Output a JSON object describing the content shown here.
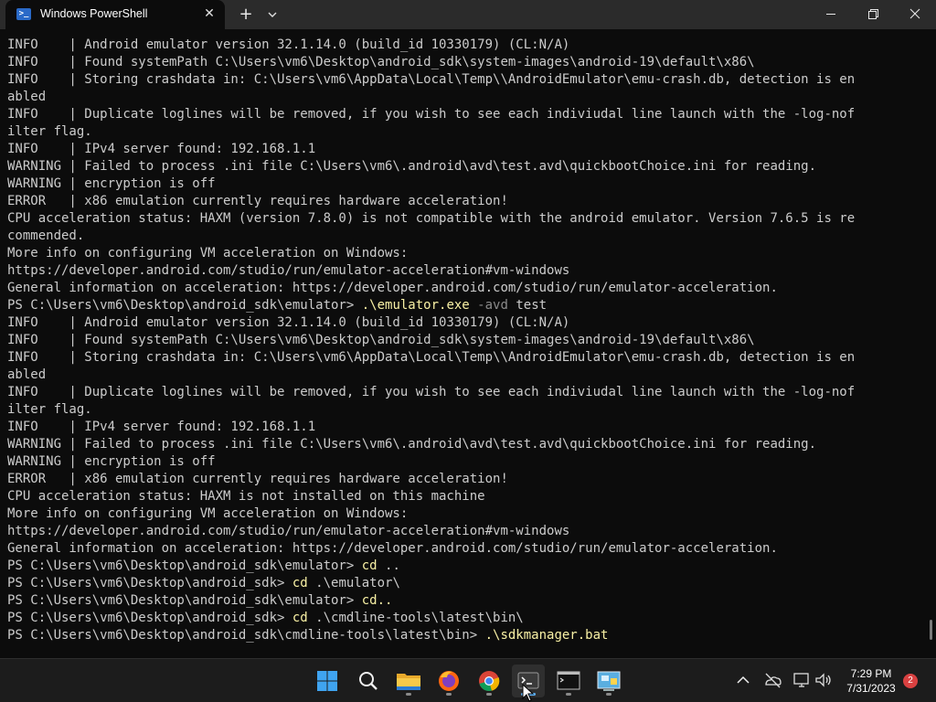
{
  "window": {
    "tab_title": "Windows PowerShell",
    "tab_icon": "powershell-icon",
    "new_tab_label": "+",
    "close_tab_label": "✕"
  },
  "colors": {
    "terminal_bg": "#0c0c0c",
    "text": "#cccccc",
    "command": "#f9f1a5",
    "parameter": "#8a8a8a",
    "titlebar": "#2b2b2b",
    "taskbar": "#1c1c1c",
    "accent": "#5fb2f7",
    "badge": "#d94141"
  },
  "terminal": {
    "lines": [
      {
        "t": "INFO    | Android emulator version 32.1.14.0 (build_id 10330179) (CL:N/A)"
      },
      {
        "t": "INFO    | Found systemPath C:\\Users\\vm6\\Desktop\\android_sdk\\system-images\\android-19\\default\\x86\\"
      },
      {
        "t": "INFO    | Storing crashdata in: C:\\Users\\vm6\\AppData\\Local\\Temp\\\\AndroidEmulator\\emu-crash.db, detection is en"
      },
      {
        "t": "abled"
      },
      {
        "t": "INFO    | Duplicate loglines will be removed, if you wish to see each indiviudal line launch with the -log-nof"
      },
      {
        "t": "ilter flag."
      },
      {
        "t": "INFO    | IPv4 server found: 192.168.1.1"
      },
      {
        "t": "WARNING | Failed to process .ini file C:\\Users\\vm6\\.android\\avd\\test.avd\\quickbootChoice.ini for reading."
      },
      {
        "t": "WARNING | encryption is off"
      },
      {
        "t": "ERROR   | x86 emulation currently requires hardware acceleration!"
      },
      {
        "t": "CPU acceleration status: HAXM (version 7.8.0) is not compatible with the android emulator. Version 7.6.5 is re"
      },
      {
        "t": "commended."
      },
      {
        "t": "More info on configuring VM acceleration on Windows:"
      },
      {
        "t": "https://developer.android.com/studio/run/emulator-acceleration#vm-windows"
      },
      {
        "t": "General information on acceleration: https://developer.android.com/studio/run/emulator-acceleration."
      },
      {
        "p": "PS C:\\Users\\vm6\\Desktop\\android_sdk\\emulator> ",
        "c": ".\\emulator.exe",
        "a": " -avd",
        "r": " test"
      },
      {
        "t": "INFO    | Android emulator version 32.1.14.0 (build_id 10330179) (CL:N/A)"
      },
      {
        "t": "INFO    | Found systemPath C:\\Users\\vm6\\Desktop\\android_sdk\\system-images\\android-19\\default\\x86\\"
      },
      {
        "t": "INFO    | Storing crashdata in: C:\\Users\\vm6\\AppData\\Local\\Temp\\\\AndroidEmulator\\emu-crash.db, detection is en"
      },
      {
        "t": "abled"
      },
      {
        "t": "INFO    | Duplicate loglines will be removed, if you wish to see each indiviudal line launch with the -log-nof"
      },
      {
        "t": "ilter flag."
      },
      {
        "t": "INFO    | IPv4 server found: 192.168.1.1"
      },
      {
        "t": "WARNING | Failed to process .ini file C:\\Users\\vm6\\.android\\avd\\test.avd\\quickbootChoice.ini for reading."
      },
      {
        "t": "WARNING | encryption is off"
      },
      {
        "t": "ERROR   | x86 emulation currently requires hardware acceleration!"
      },
      {
        "t": "CPU acceleration status: HAXM is not installed on this machine"
      },
      {
        "t": "More info on configuring VM acceleration on Windows:"
      },
      {
        "t": "https://developer.android.com/studio/run/emulator-acceleration#vm-windows"
      },
      {
        "t": "General information on acceleration: https://developer.android.com/studio/run/emulator-acceleration."
      },
      {
        "p": "PS C:\\Users\\vm6\\Desktop\\android_sdk\\emulator> ",
        "c": "cd",
        "r": " .."
      },
      {
        "p": "PS C:\\Users\\vm6\\Desktop\\android_sdk> ",
        "c": "cd",
        "r": " .\\emulator\\"
      },
      {
        "p": "PS C:\\Users\\vm6\\Desktop\\android_sdk\\emulator> ",
        "c": "cd..",
        "r": ""
      },
      {
        "p": "PS C:\\Users\\vm6\\Desktop\\android_sdk> ",
        "c": "cd",
        "r": " .\\cmdline-tools\\latest\\bin\\"
      },
      {
        "p": "PS C:\\Users\\vm6\\Desktop\\android_sdk\\cmdline-tools\\latest\\bin> ",
        "c": ".\\sdkmanager.bat",
        "r": ""
      }
    ]
  },
  "taskbar": {
    "apps": [
      {
        "icon": "windows-start-icon",
        "active": false,
        "open": false
      },
      {
        "icon": "search-icon",
        "active": false,
        "open": false
      },
      {
        "icon": "file-explorer-icon",
        "active": false,
        "open": true
      },
      {
        "icon": "firefox-icon",
        "active": false,
        "open": true
      },
      {
        "icon": "chrome-icon",
        "active": false,
        "open": true
      },
      {
        "icon": "terminal-icon",
        "active": true,
        "open": true
      },
      {
        "icon": "command-prompt-icon",
        "active": false,
        "open": true
      },
      {
        "icon": "control-panel-icon",
        "active": false,
        "open": true
      }
    ],
    "tray_icons": [
      "chevron-up-icon",
      "network-offline-icon",
      "display-icon",
      "volume-icon"
    ],
    "time": "7:29 PM",
    "date": "7/31/2023",
    "notification_count": "2"
  }
}
